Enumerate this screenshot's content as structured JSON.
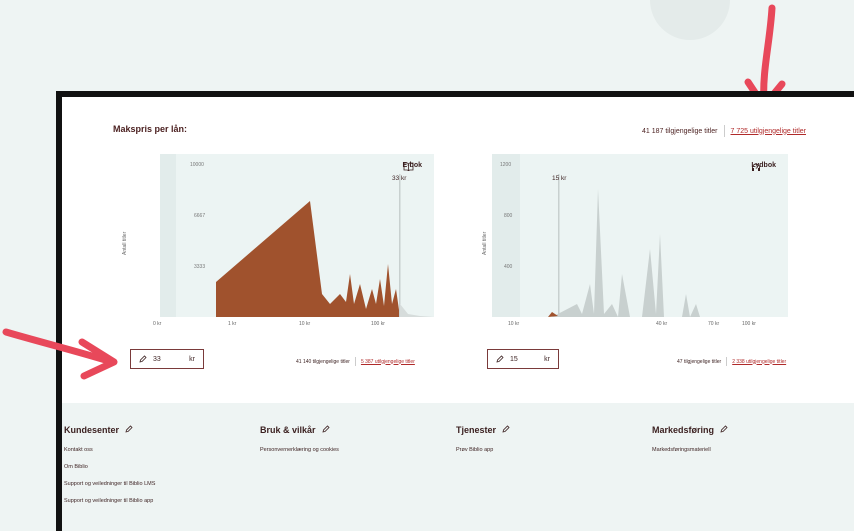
{
  "panel": {
    "title": "Makspris per lån:",
    "available": "41 187 tilgjengelige titler",
    "unavailable": "7 725 utilgjengelige titler"
  },
  "ebook": {
    "label": "E-bok",
    "icon": "book-icon",
    "axis_label": "Antall titler",
    "marker": "33 kr",
    "input_value": "33",
    "unit": "kr",
    "available": "41 140 tilgjengelige titler",
    "unavailable": "5 387 utilgjengelige titler",
    "y_ticks": [
      "10000",
      "6667",
      "3333"
    ],
    "x_ticks": [
      "0 kr",
      "1 kr",
      "10 kr",
      "100 kr"
    ],
    "color": "#a0522d"
  },
  "audiobook": {
    "label": "Lydbok",
    "icon": "headphones-icon",
    "axis_label": "Antall titler",
    "marker": "15 kr",
    "input_value": "15",
    "unit": "kr",
    "available": "47 tilgjengelige titler",
    "unavailable": "2 338 utilgjengelige titler",
    "y_ticks": [
      "1200",
      "800",
      "400"
    ],
    "x_ticks": [
      "10 kr",
      "40 kr",
      "70 kr",
      "100 kr"
    ],
    "color": "#c8d0cf"
  },
  "footer": {
    "columns": [
      {
        "title": "Kundesenter",
        "links": [
          "Kontakt oss",
          "Om Biblio",
          "Support og veiledninger til Biblio LMS",
          "Support og veiledninger til Biblio app"
        ]
      },
      {
        "title": "Bruk & vilkår",
        "links": [
          "Personvernerklæring og cookies"
        ]
      },
      {
        "title": "Tjenester",
        "links": [
          "Prøv Biblio app"
        ]
      },
      {
        "title": "Markedsføring",
        "links": [
          "Markedsføringsmateriell"
        ]
      }
    ]
  },
  "colors": {
    "accent": "#e8485a",
    "link": "#b02a2a",
    "ebook_fill": "#a0522d",
    "audio_fill": "#c8d0cf"
  }
}
